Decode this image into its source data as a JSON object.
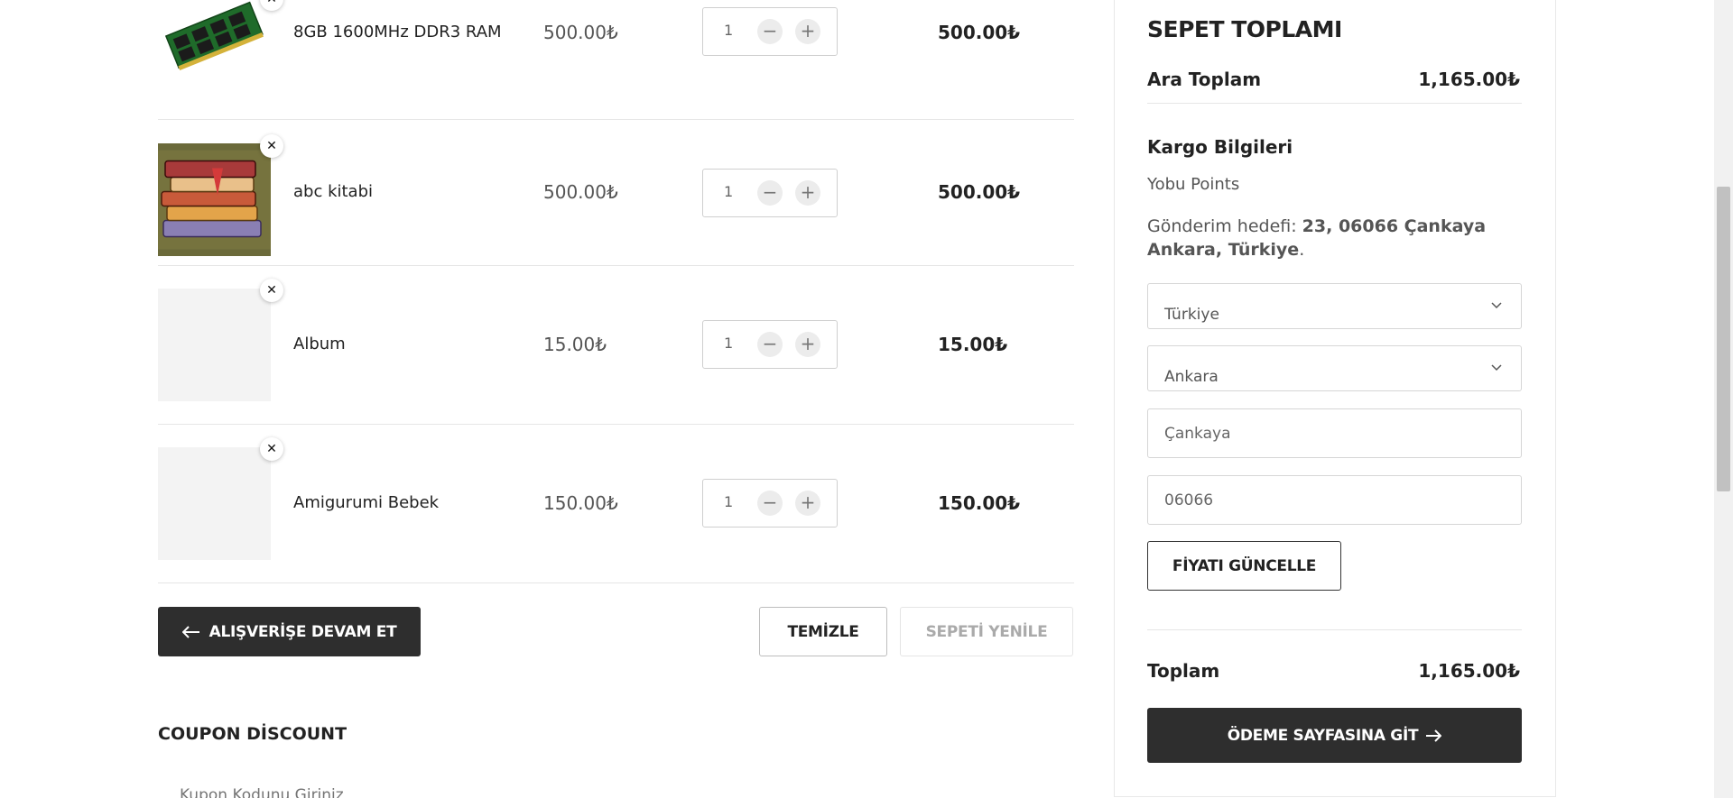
{
  "cart": {
    "items": [
      {
        "name": "8GB 1600MHz DDR3 RAM",
        "price": "500.00₺",
        "qty": "1",
        "subtotal": "500.00₺",
        "image": "ram-module"
      },
      {
        "name": "abc kitabi",
        "price": "500.00₺",
        "qty": "1",
        "subtotal": "500.00₺",
        "image": "books-stack"
      },
      {
        "name": "Album",
        "price": "15.00₺",
        "qty": "1",
        "subtotal": "15.00₺",
        "image": "placeholder"
      },
      {
        "name": "Amigurumi Bebek",
        "price": "150.00₺",
        "qty": "1",
        "subtotal": "150.00₺",
        "image": "placeholder"
      }
    ],
    "remove_glyph": "✕",
    "minus_glyph": "−",
    "plus_glyph": "+",
    "continue_label": "ALIŞVERİŞE DEVAM ET",
    "clear_label": "TEMİZLE",
    "update_label": "SEPETİ YENİLE"
  },
  "coupon": {
    "title": "COUPON DİSCOUNT",
    "placeholder": "Kupon Kodunu Giriniz"
  },
  "totals": {
    "title": "SEPET TOPLAMI",
    "subtotal_label": "Ara Toplam",
    "subtotal_value": "1,165.00₺",
    "shipping_title": "Kargo Bilgileri",
    "shipping_method": "Yobu Points",
    "destination_prefix": "Gönderim hedefi: ",
    "destination_line1": "23, 06066 Çankaya",
    "destination_line2": "Ankara, Türkiye",
    "destination_suffix": ".",
    "country": "Türkiye",
    "province": "Ankara",
    "district": "Çankaya",
    "postcode": "06066",
    "update_price_label": "FİYATI GÜNCELLE",
    "total_label": "Toplam",
    "total_value": "1,165.00₺",
    "checkout_label": "ÖDEME SAYFASINA GİT"
  },
  "colors": {
    "dark_button": "#2e2e2e",
    "border": "#d6d6d6",
    "muted_text": "#555555"
  }
}
